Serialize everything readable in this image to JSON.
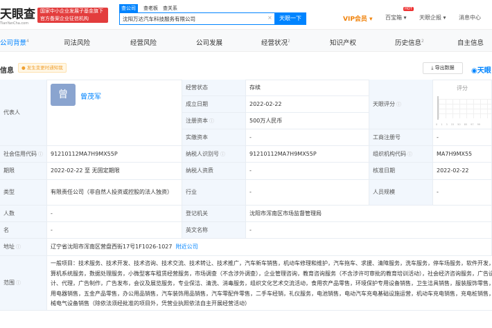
{
  "header": {
    "logo": "天眼查",
    "logo_sub": "TianYanCha.com",
    "badge_line1": "国家中小企业发展子基金旗下",
    "badge_line2": "官方备案企业征信机构",
    "search_tabs": [
      "查公司",
      "查老板",
      "查关系"
    ],
    "search_value": "沈阳万达汽车科技服务有限公司",
    "clear": "×",
    "search_button": "天眼一下",
    "vip": "VIP会员 ▾",
    "hot": "HOT",
    "baibao": "百宝箱 ▾",
    "report": "天眼企报 ▾",
    "messages": "消息中心"
  },
  "nav": [
    {
      "label": "公司背景",
      "count": "4"
    },
    {
      "label": "司法风险",
      "count": ""
    },
    {
      "label": "经营风险",
      "count": ""
    },
    {
      "label": "公司发展",
      "count": ""
    },
    {
      "label": "经营状况",
      "count": "2"
    },
    {
      "label": "知识产权",
      "count": ""
    },
    {
      "label": "历史信息",
      "count": "2"
    },
    {
      "label": "自主信息",
      "count": ""
    }
  ],
  "section": {
    "title": "信息",
    "notify": "发生变更时通知我",
    "export": "导出数据",
    "brand": "天眼"
  },
  "info": {
    "legal_rep_label": "代表人",
    "avatar_char": "曾",
    "legal_rep": "曾茂军",
    "status_label": "经营状态",
    "status": "存续",
    "founded_label": "成立日期",
    "founded": "2022-02-22",
    "capital_label": "注册资本",
    "capital": "500万人民币",
    "paid_label": "实缴资本",
    "paid": "-",
    "score_label": "天眼评分",
    "score_title": "评分",
    "score_ticks": [
      "0",
      "1",
      "3",
      "15",
      "50",
      "85",
      "97",
      "99"
    ],
    "biz_reg_label": "工商注册号",
    "biz_reg": "-",
    "credit_label": "社会信用代码",
    "credit": "91210112MA7H9MX55P",
    "taxid_label": "纳税人识别号",
    "taxid": "91210112MA7H9MX55P",
    "org_label": "组织机构代码",
    "org": "MA7H9MX55",
    "period_label": "期限",
    "period": "2022-02-22 至 无固定期限",
    "taxpayer_label": "纳税人资质",
    "taxpayer": "-",
    "approve_label": "核准日期",
    "approve": "2022-02-22",
    "type_label": "类型",
    "type": "有限责任公司（非自然人投资或控股的法人独资）",
    "industry_label": "行业",
    "industry": "-",
    "size_label": "人员规模",
    "size": "-",
    "staff_label": "人数",
    "staff": "-",
    "authority_label": "登记机关",
    "authority": "沈阳市浑南区市场监督管理局",
    "name_label": "名",
    "name": "-",
    "en_label": "英文名称",
    "en": "-",
    "addr_label": "地址",
    "addr": "辽宁省沈阳市浑南区营盘西街17号1F1026-1027",
    "nearby": "附近公司",
    "scope_label": "范围",
    "scope": "一般项目：技术服务、技术开发、技术咨询、技术交流、技术转让、技术推广，汽车新车销售，机动车修理和维护，汽车拖车、求援、清障服务，洗车服务，停车场服务，软件开发，计算机系统服务，数据处理服务，小微型客车租赁经营服务，市场调查（不含涉外调查），企业管理咨询，教育咨询服务（不含涉许可审批的教育培训活动），社会经济咨询服务，广告设计、代理，广告制作，广告发布，会议及展览服务，专业保洁、清洗、消毒服务，组织文化艺术交流活动，食用农产品零售，环境保护专用设备销售，卫生洁具销售，服装服饰零售，家用电器销售，五金产品零售，办公用品销售，汽车装饰用品销售，汽车零配件零售，二手车经销，礼仪服务，电池销售，电动汽车充电基础设施运营，机动车充电销售，充电桩销售，机械电气设备销售（除依法须经批准的项目外，凭营业执照依法自主开展经营活动）"
  },
  "colors": {
    "accent": "#0084ff",
    "label_bg": "#f2f7fd",
    "badge": "#e33d3d",
    "vip": "#f0820a"
  }
}
